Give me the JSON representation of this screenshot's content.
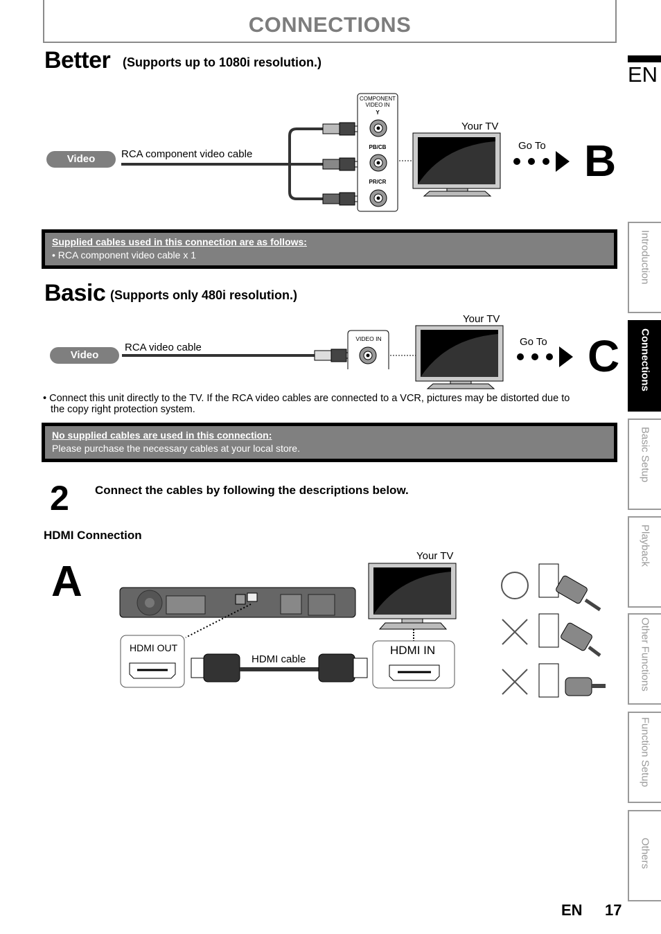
{
  "header": {
    "title": "CONNECTIONS"
  },
  "better": {
    "title": "Better",
    "subtitle": "(Supports up to 1080i resolution.)",
    "pill": "Video",
    "cable_label": "RCA component video cable",
    "jack_panel_title_1": "COMPONENT",
    "jack_panel_title_2": "VIDEO IN",
    "jacks": [
      "Y",
      "PB/CB",
      "PR/CR"
    ],
    "tv_label": "Your TV",
    "goto_label": "Go To",
    "goto_target": "B",
    "note": {
      "title": "Supplied cables used in this connection are as follows:",
      "line": "• RCA component video cable x 1"
    }
  },
  "basic": {
    "title": "Basic",
    "subtitle": "(Supports only 480i resolution.)",
    "pill": "Video",
    "cable_label": "RCA video cable",
    "jack_panel_title": "VIDEO IN",
    "tv_label": "Your TV",
    "goto_label": "Go To",
    "goto_target": "C",
    "bullet_line_1": "• Connect this unit directly to the TV. If the RCA video cables are connected to a VCR, pictures may be distorted due to",
    "bullet_line_2": "the copy right protection system.",
    "note": {
      "title": "No supplied cables are used in this connection:",
      "line": "Please purchase the necessary cables at your local store."
    }
  },
  "step2": {
    "number": "2",
    "text": "Connect the cables by following the descriptions below."
  },
  "hdmi": {
    "heading": "HDMI Connection",
    "letter": "A",
    "tv_label": "Your TV",
    "out_label": "HDMI OUT",
    "in_label": "HDMI IN",
    "cable_label": "HDMI cable",
    "insertion_examples": [
      {
        "mark": "correct",
        "icon": "circle-icon"
      },
      {
        "mark": "incorrect",
        "icon": "cross-icon"
      },
      {
        "mark": "incorrect",
        "icon": "cross-icon"
      }
    ]
  },
  "sidebar": {
    "language": "EN",
    "tabs": [
      {
        "label": "Introduction",
        "active": false
      },
      {
        "label": "Connections",
        "active": true
      },
      {
        "label": "Basic Setup",
        "active": false
      },
      {
        "label": "Playback",
        "active": false
      },
      {
        "label": "Other Functions",
        "active": false
      },
      {
        "label": "Function Setup",
        "active": false
      },
      {
        "label": "Others",
        "active": false
      }
    ]
  },
  "footer": {
    "language": "EN",
    "page": "17"
  }
}
